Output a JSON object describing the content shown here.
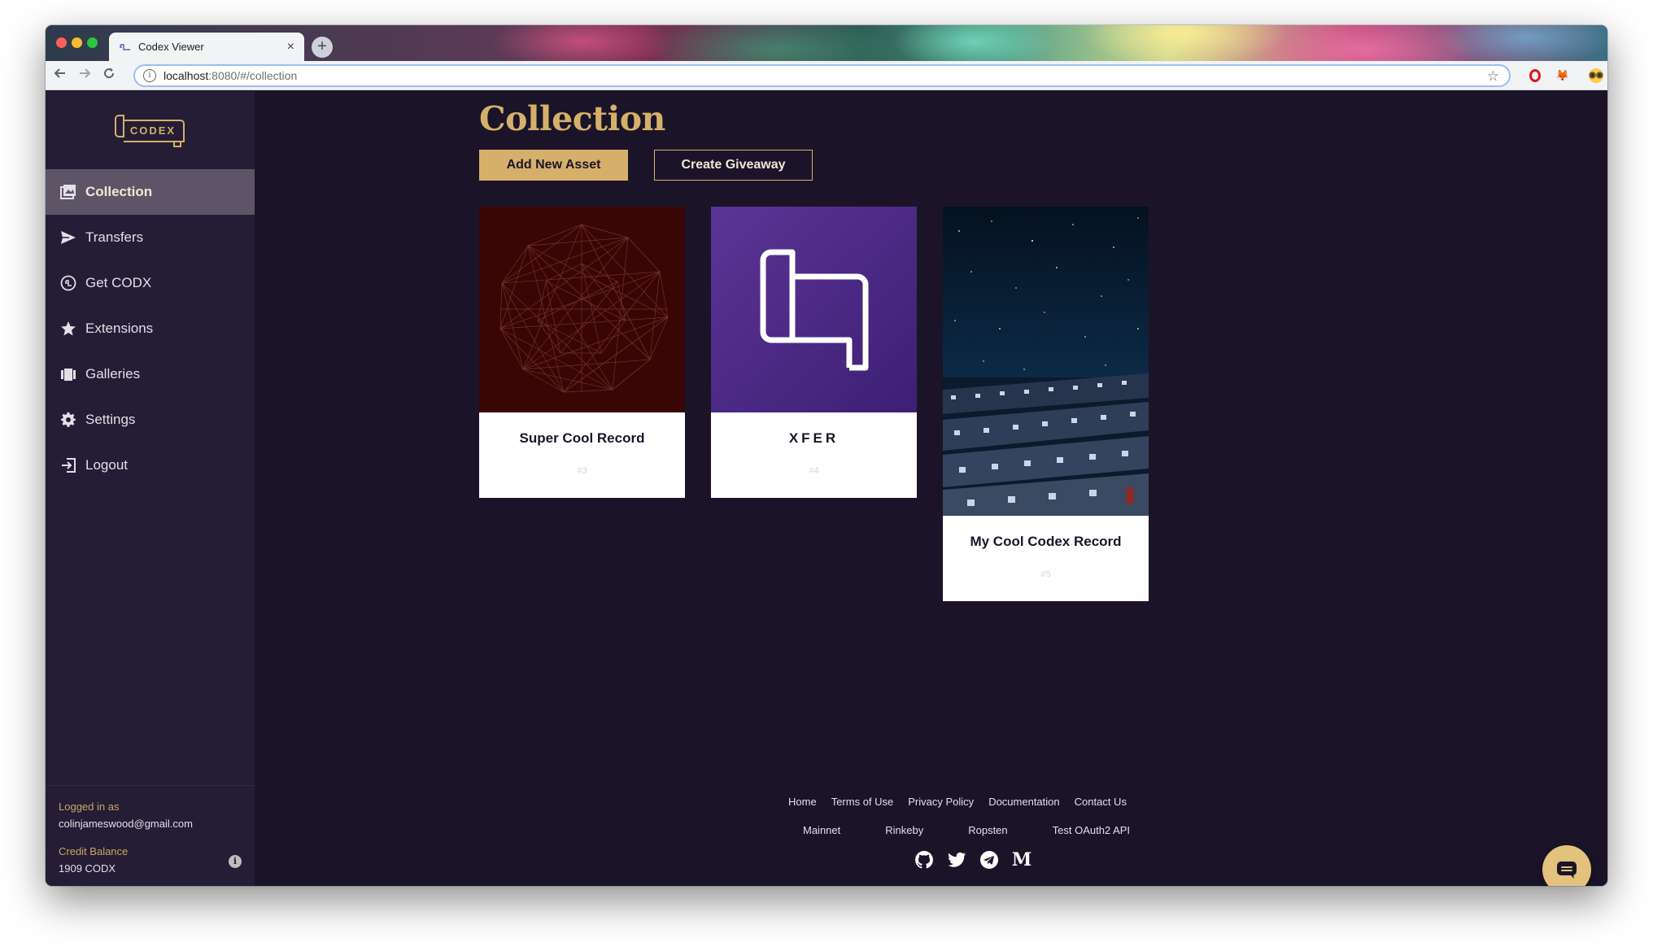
{
  "browser": {
    "tab_title": "Codex Viewer",
    "tab_close": "×",
    "new_tab": "+",
    "url_host": "localhost",
    "url_path": ":8080/#/collection"
  },
  "sidebar": {
    "logo_text": "CODEX",
    "items": [
      {
        "label": "Collection",
        "icon": "collection-icon",
        "active": true
      },
      {
        "label": "Transfers",
        "icon": "send-icon"
      },
      {
        "label": "Get CODX",
        "icon": "coin-icon"
      },
      {
        "label": "Extensions",
        "icon": "star-icon"
      },
      {
        "label": "Galleries",
        "icon": "gallery-icon"
      },
      {
        "label": "Settings",
        "icon": "gear-icon"
      },
      {
        "label": "Logout",
        "icon": "logout-icon"
      }
    ],
    "account": {
      "logged_in_label": "Logged in as",
      "email": "colinjameswood@gmail.com",
      "credit_label": "Credit Balance",
      "credit_value": "1909 CODX"
    }
  },
  "main": {
    "title": "Collection",
    "add_button": "Add New Asset",
    "giveaway_button": "Create Giveaway",
    "cards": [
      {
        "name": "Super Cool Record",
        "id": "#3"
      },
      {
        "name": "XFER",
        "id": "#4"
      },
      {
        "name": "My Cool Codex Record",
        "id": "#5"
      }
    ]
  },
  "footer": {
    "links_row1": [
      "Home",
      "Terms of Use",
      "Privacy Policy",
      "Documentation",
      "Contact Us"
    ],
    "links_row2": [
      "Mainnet",
      "Rinkeby",
      "Ropsten",
      "Test OAuth2 API"
    ],
    "social": [
      "github-icon",
      "twitter-icon",
      "telegram-icon",
      "medium-icon"
    ],
    "medium_letter": "M"
  },
  "colors": {
    "accent": "#d6b06a",
    "background": "#1b1429",
    "sidebar": "#241d35",
    "active_item": "#5d5567"
  }
}
